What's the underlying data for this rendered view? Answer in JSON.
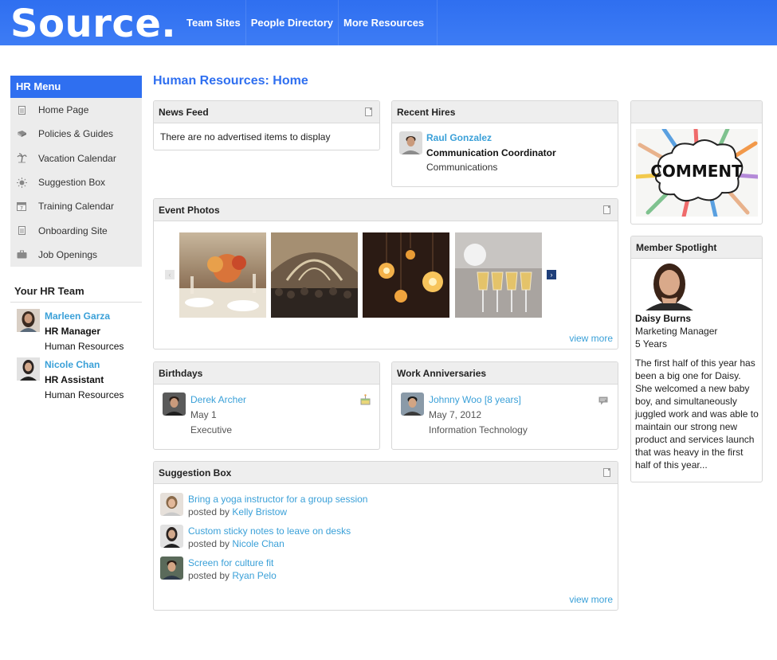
{
  "brand": {
    "name": "Source",
    "dot": "."
  },
  "topnav": [
    "Team Sites",
    "People Directory",
    "More Resources"
  ],
  "hr_menu": {
    "title": "HR Menu",
    "items": [
      {
        "label": "Home Page",
        "icon": "page-icon"
      },
      {
        "label": "Policies & Guides",
        "icon": "book-icon"
      },
      {
        "label": "Vacation Calendar",
        "icon": "palm-tree-icon"
      },
      {
        "label": "Suggestion Box",
        "icon": "lightbulb-icon"
      },
      {
        "label": "Training Calendar",
        "icon": "calendar-icon"
      },
      {
        "label": "Onboarding Site",
        "icon": "page-icon"
      },
      {
        "label": "Job Openings",
        "icon": "briefcase-icon"
      }
    ]
  },
  "hr_team": {
    "title": "Your HR Team",
    "members": [
      {
        "name": "Marleen Garza",
        "role": "HR Manager",
        "dept": "Human Resources"
      },
      {
        "name": "Nicole Chan",
        "role": "HR Assistant",
        "dept": "Human Resources"
      }
    ]
  },
  "page_title": "Human Resources: Home",
  "news_feed": {
    "title": "News Feed",
    "empty": "There are no advertised items to display"
  },
  "recent_hires": {
    "title": "Recent Hires",
    "name": "Raul Gonzalez",
    "role": "Communication Coordinator",
    "dept": "Communications"
  },
  "event_photos": {
    "title": "Event Photos",
    "view_more": "view more"
  },
  "comment_image": {
    "text": "COMMENT"
  },
  "member_spotlight": {
    "title": "Member Spotlight",
    "name": "Daisy Burns",
    "role": "Marketing Manager",
    "years": "5 Years",
    "blurb": "The first half of this year has been a big one for Daisy. She welcomed a new baby boy, and simultaneously juggled work and was able to maintain our strong new product and services launch that was heavy in the first half of this year..."
  },
  "birthdays": {
    "title": "Birthdays",
    "name": "Derek Archer",
    "date": "May 1",
    "dept": "Executive"
  },
  "anniversaries": {
    "title": "Work Anniversaries",
    "name": "Johnny Woo [8 years]",
    "date": "May 7, 2012",
    "dept": "Information Technology"
  },
  "suggestion_box": {
    "title": "Suggestion Box",
    "posted_by_label": "posted by",
    "items": [
      {
        "text": "Bring a yoga instructor for a group session",
        "author": "Kelly Bristow"
      },
      {
        "text": "Custom sticky notes to leave on desks",
        "author": "Nicole Chan"
      },
      {
        "text": "Screen for culture fit",
        "author": "Ryan Pelo"
      }
    ],
    "view_more": "view more"
  },
  "colors": {
    "brand_blue": "#2f6ff0",
    "link": "#3aa0d8"
  }
}
